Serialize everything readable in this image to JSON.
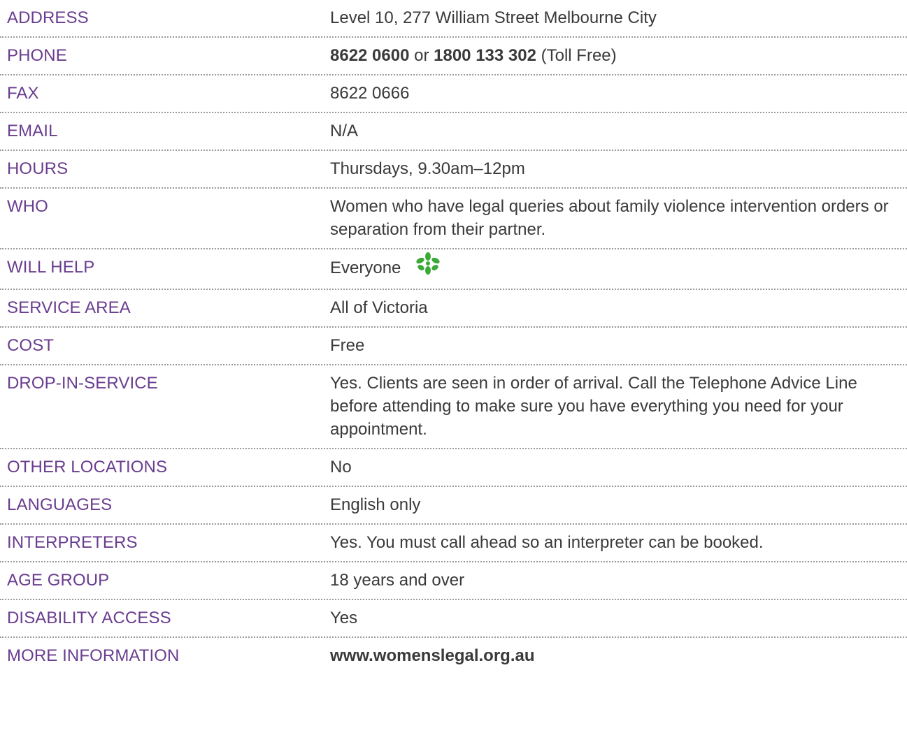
{
  "rows": [
    {
      "label": "ADDRESS",
      "value": "Level 10, 277 William Street Melbourne City"
    },
    {
      "label": "PHONE",
      "phone1": "8622 0600",
      "joiner": " or ",
      "phone2": "1800 133 302",
      "suffix": " (Toll Free)"
    },
    {
      "label": "FAX",
      "value": "8622 0666"
    },
    {
      "label": "EMAIL",
      "value": "N/A"
    },
    {
      "label": "HOURS",
      "value": "Thursdays, 9.30am–12pm"
    },
    {
      "label": "WHO",
      "value": "Women who have legal queries about family violence intervention orders or separation from their partner."
    },
    {
      "label": "WILL HELP",
      "value": "Everyone",
      "icon": "green-flower-icon",
      "icon_color": "#3aa935"
    },
    {
      "label": "SERVICE AREA",
      "value": "All of Victoria"
    },
    {
      "label": "COST",
      "value": "Free"
    },
    {
      "label": "DROP-IN-SERVICE",
      "value": "Yes. Clients are seen in order of arrival. Call the Telephone Advice Line before attending to make sure you have everything you need for your appointment."
    },
    {
      "label": "OTHER LOCATIONS",
      "value": "No"
    },
    {
      "label": "LANGUAGES",
      "value": "English only"
    },
    {
      "label": "INTERPRETERS",
      "value": "Yes. You must call ahead so an interpreter can be booked."
    },
    {
      "label": "AGE GROUP",
      "value": "18 years and over"
    },
    {
      "label": "DISABILITY ACCESS",
      "value": "Yes"
    },
    {
      "label": "MORE INFORMATION",
      "value": "www.womenslegal.org.au"
    }
  ],
  "colors": {
    "label": "#6a3d8f",
    "value": "#3a3a3a",
    "divider": "#9a9a9a",
    "icon": "#3aa935"
  }
}
